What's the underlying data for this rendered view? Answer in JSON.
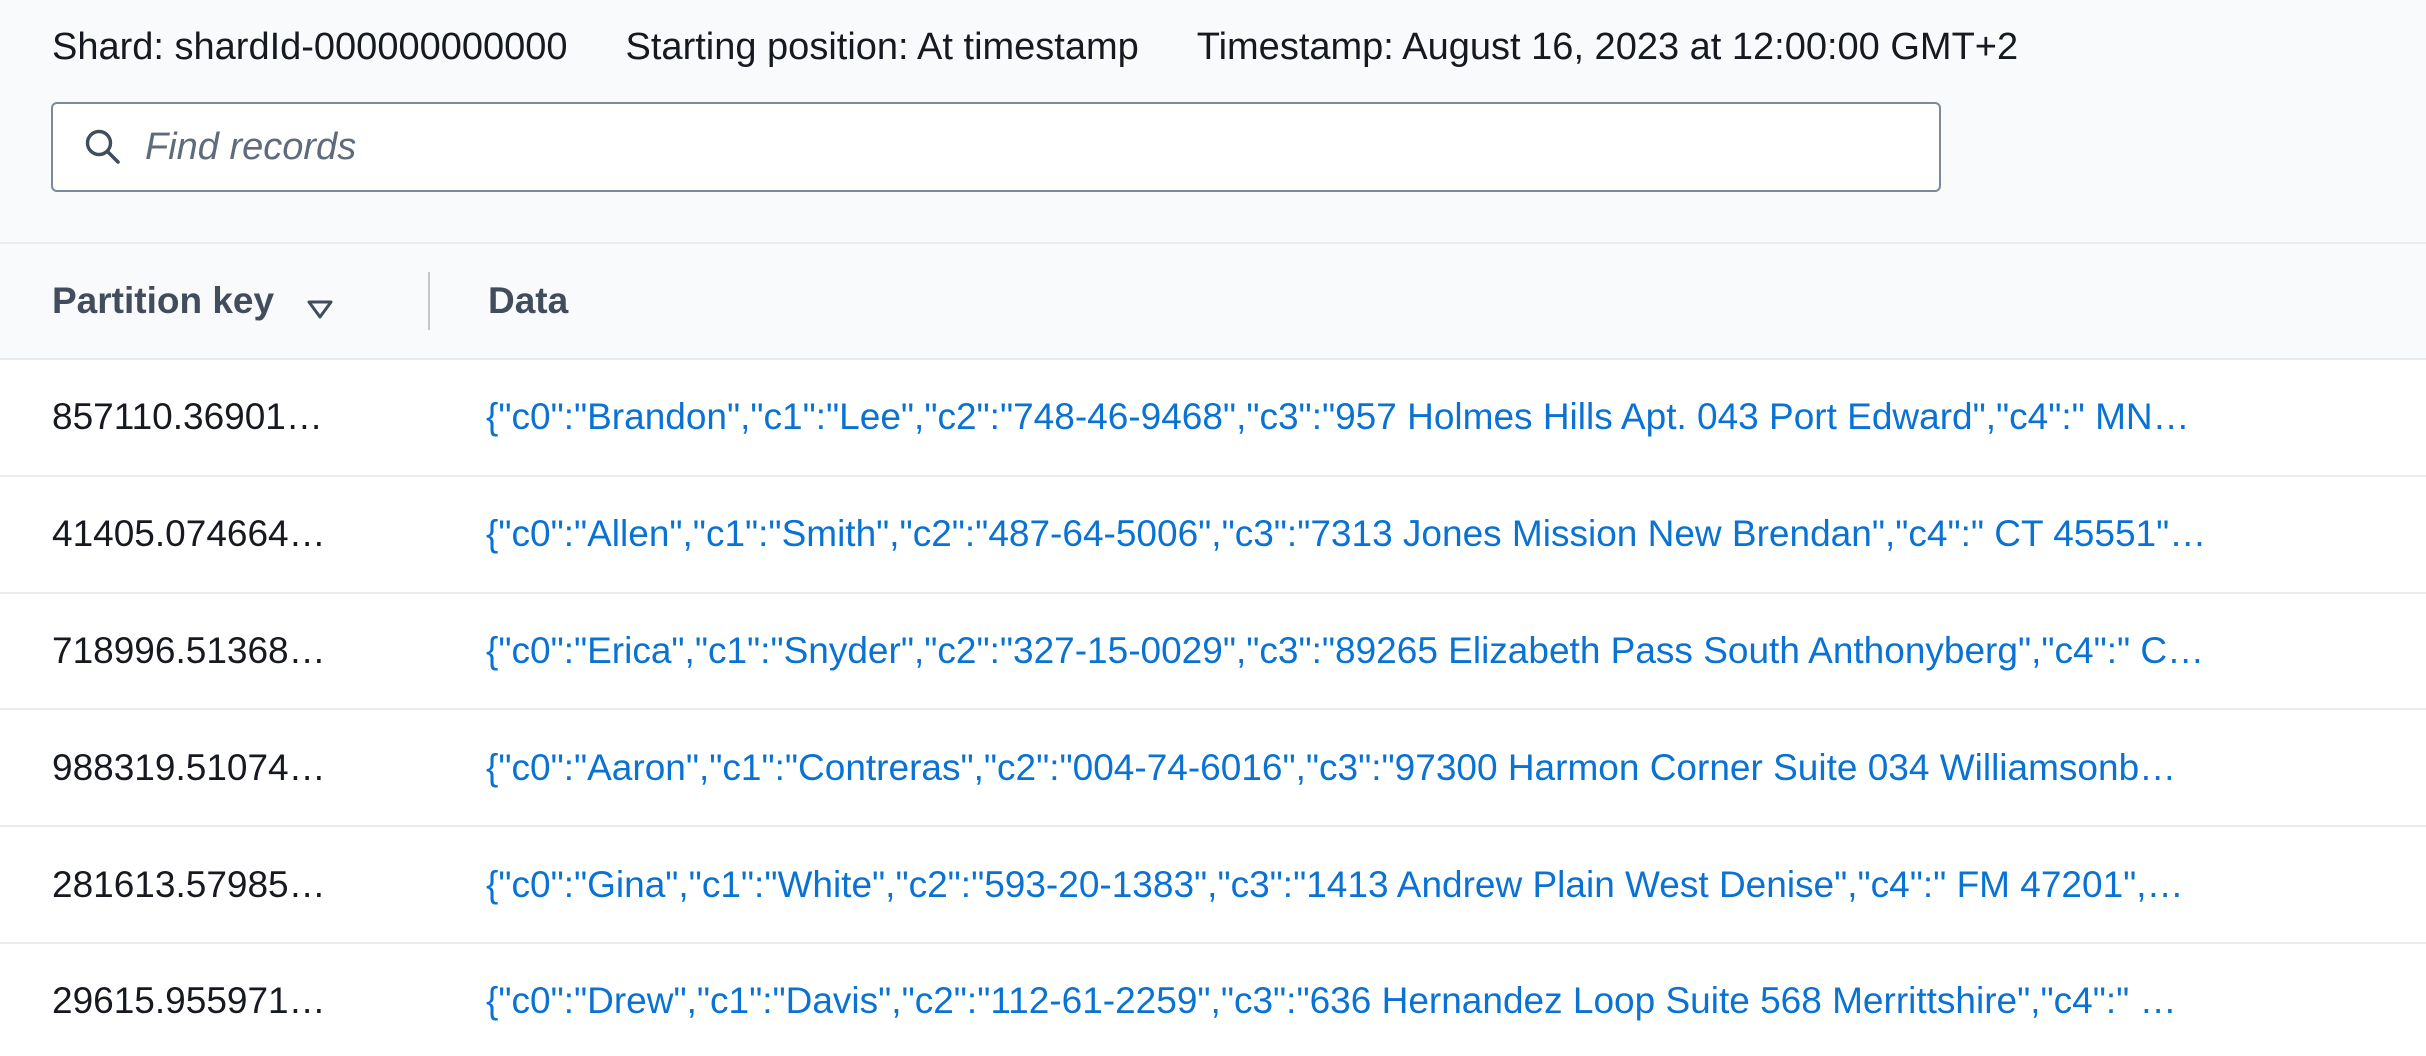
{
  "header": {
    "shard": "Shard: shardId-000000000000",
    "starting_position": "Starting position: At timestamp",
    "timestamp": "Timestamp: August 16, 2023 at 12:00:00 GMT+2"
  },
  "search": {
    "placeholder": "Find records",
    "icon": "search-icon"
  },
  "table": {
    "columns": [
      "Partition key",
      "Data"
    ],
    "sort_icon": "caret-down-icon",
    "rows": [
      {
        "key": "857110.36901…",
        "data": "{\"c0\":\"Brandon\",\"c1\":\"Lee\",\"c2\":\"748-46-9468\",\"c3\":\"957 Holmes Hills Apt. 043 Port Edward\",\"c4\":\" MN…"
      },
      {
        "key": "41405.074664…",
        "data": "{\"c0\":\"Allen\",\"c1\":\"Smith\",\"c2\":\"487-64-5006\",\"c3\":\"7313 Jones Mission New Brendan\",\"c4\":\" CT 45551\"…"
      },
      {
        "key": "718996.51368…",
        "data": "{\"c0\":\"Erica\",\"c1\":\"Snyder\",\"c2\":\"327-15-0029\",\"c3\":\"89265 Elizabeth Pass South Anthonyberg\",\"c4\":\" C…"
      },
      {
        "key": "988319.51074…",
        "data": "{\"c0\":\"Aaron\",\"c1\":\"Contreras\",\"c2\":\"004-74-6016\",\"c3\":\"97300 Harmon Corner Suite 034 Williamsonb…"
      },
      {
        "key": "281613.57985…",
        "data": "{\"c0\":\"Gina\",\"c1\":\"White\",\"c2\":\"593-20-1383\",\"c3\":\"1413 Andrew Plain West Denise\",\"c4\":\" FM 47201\",…"
      },
      {
        "key": "29615.955971…",
        "data": "{\"c0\":\"Drew\",\"c1\":\"Davis\",\"c2\":\"112-61-2259\",\"c3\":\"636 Hernandez Loop Suite 568 Merrittshire\",\"c4\":\" …"
      }
    ]
  },
  "colors": {
    "link": "#0972d3",
    "text": "#16191f",
    "header_text": "#414d5c",
    "border": "#e9ebed"
  }
}
